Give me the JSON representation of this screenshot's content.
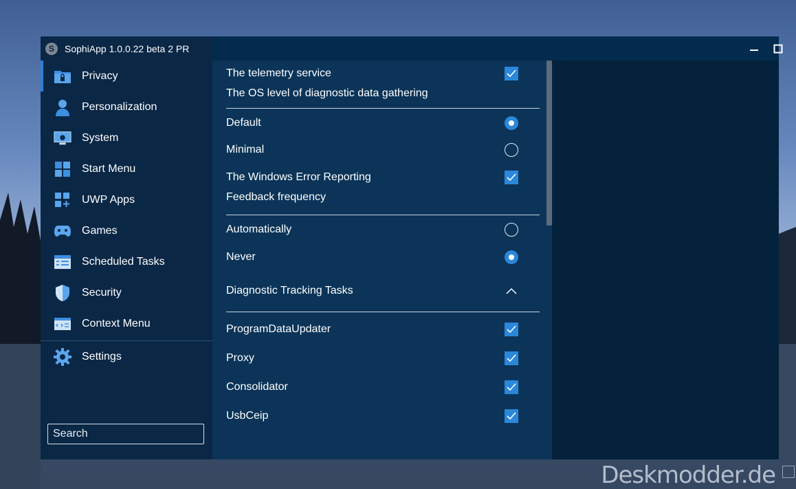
{
  "background": {
    "watermark": "Deskmodder.de"
  },
  "window": {
    "title": "SophiApp 1.0.0.22 beta 2 PR",
    "controls": {
      "minimize": "minimize-icon",
      "maximize": "maximize-icon",
      "close": "close-icon"
    }
  },
  "sidebar": {
    "items": [
      {
        "label": "Privacy",
        "icon": "privacy-icon",
        "active": true
      },
      {
        "label": "Personalization",
        "icon": "person-icon"
      },
      {
        "label": "System",
        "icon": "monitor-icon"
      },
      {
        "label": "Start Menu",
        "icon": "windows-logo-icon"
      },
      {
        "label": "UWP Apps",
        "icon": "apps-grid-icon"
      },
      {
        "label": "Games",
        "icon": "gamepad-icon"
      },
      {
        "label": "Scheduled Tasks",
        "icon": "task-list-icon"
      },
      {
        "label": "Security",
        "icon": "shield-icon"
      },
      {
        "label": "Context Menu",
        "icon": "context-menu-icon"
      }
    ],
    "settings": {
      "label": "Settings",
      "icon": "gear-icon"
    },
    "search": {
      "placeholder": "Search"
    }
  },
  "content": {
    "telemetry": {
      "label": "The telemetry service",
      "checked": true
    },
    "diag_heading": "The OS level of diagnostic data gathering",
    "diag_options": [
      {
        "label": "Default",
        "selected": true
      },
      {
        "label": "Minimal",
        "selected": false
      }
    ],
    "wer": {
      "label": "The Windows Error Reporting",
      "checked": true
    },
    "feedback_heading": "Feedback frequency",
    "feedback_options": [
      {
        "label": "Automatically",
        "selected": false
      },
      {
        "label": "Never",
        "selected": true
      }
    ],
    "tracking_heading": "Diagnostic Tracking Tasks",
    "tasks": [
      {
        "label": "ProgramDataUpdater",
        "checked": true
      },
      {
        "label": "Proxy",
        "checked": true
      },
      {
        "label": "Consolidator",
        "checked": true
      },
      {
        "label": "UsbCeip",
        "checked": true
      }
    ]
  },
  "colors": {
    "accent": "#2b87d9",
    "sidebar": "#0a2745",
    "content": "#0b3458",
    "right_panel": "#05223d"
  }
}
